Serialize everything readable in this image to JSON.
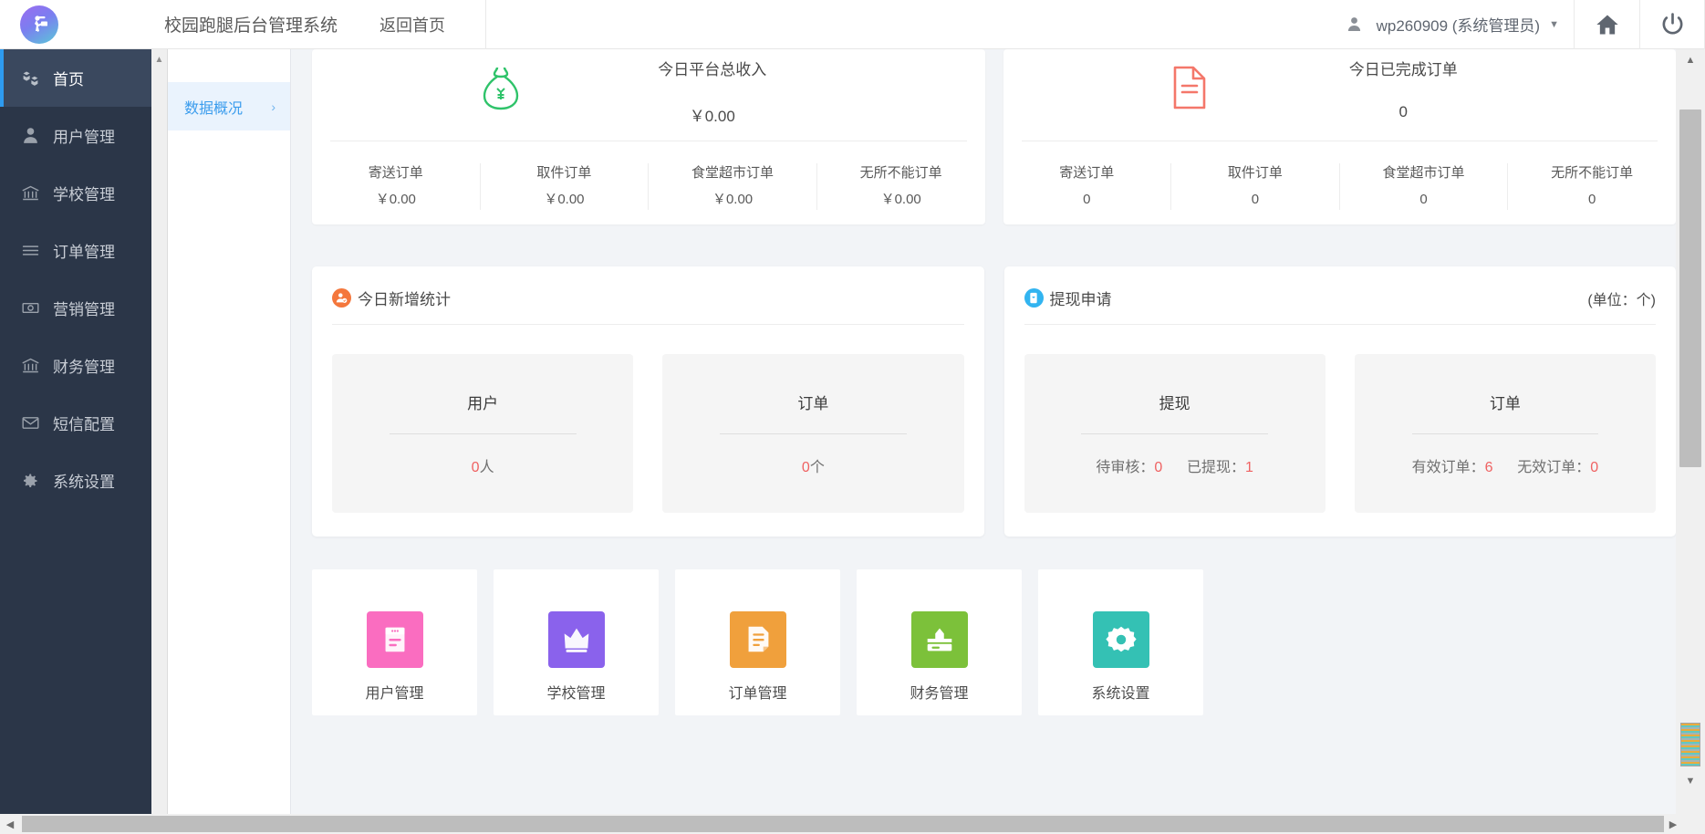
{
  "header": {
    "app_title": "校园跑腿后台管理系统",
    "home_link": "返回首页",
    "user_name": "wp260909 (系统管理员)",
    "caret": "▼",
    "home_button_name": "home",
    "power_button_name": "logout"
  },
  "sidebar": {
    "items": [
      {
        "label": "首页",
        "icon": "cubes-icon",
        "active": true
      },
      {
        "label": "用户管理",
        "icon": "user-icon",
        "active": false
      },
      {
        "label": "学校管理",
        "icon": "bank-icon",
        "active": false
      },
      {
        "label": "订单管理",
        "icon": "list-icon",
        "active": false
      },
      {
        "label": "营销管理",
        "icon": "money-icon",
        "active": false
      },
      {
        "label": "财务管理",
        "icon": "bank-icon",
        "active": false
      },
      {
        "label": "短信配置",
        "icon": "envelope-icon",
        "active": false
      },
      {
        "label": "系统设置",
        "icon": "gear-icon",
        "active": false
      }
    ]
  },
  "subnav": {
    "items": [
      {
        "label": "数据概况",
        "chevron": "›"
      }
    ]
  },
  "top_cards": [
    {
      "icon": "money-bag-icon",
      "icon_color": "#2fc36a",
      "title": "今日平台总收入",
      "value": "￥0.00",
      "sub": [
        {
          "label": "寄送订单",
          "value": "￥0.00"
        },
        {
          "label": "取件订单",
          "value": "￥0.00"
        },
        {
          "label": "食堂超市订单",
          "value": "￥0.00"
        },
        {
          "label": "无所不能订单",
          "value": "￥0.00"
        }
      ]
    },
    {
      "icon": "document-icon",
      "icon_color": "#f4776a",
      "title": "今日已完成订单",
      "value": "0",
      "sub": [
        {
          "label": "寄送订单",
          "value": "0"
        },
        {
          "label": "取件订单",
          "value": "0"
        },
        {
          "label": "食堂超市订单",
          "value": "0"
        },
        {
          "label": "无所不能订单",
          "value": "0"
        }
      ]
    }
  ],
  "panels": [
    {
      "title": "今日新增统计",
      "badge_icon": "user-add-icon",
      "badge_color": "#f4773c",
      "unit": "",
      "tiles": [
        {
          "title": "用户",
          "value_num": "0",
          "value_unit": "人",
          "parts": []
        },
        {
          "title": "订单",
          "value_num": "0",
          "value_unit": "个",
          "parts": []
        }
      ]
    },
    {
      "title": "提现申请",
      "badge_icon": "withdraw-icon",
      "badge_color": "#32b4f0",
      "unit": "(单位：个)",
      "tiles": [
        {
          "title": "提现",
          "parts": [
            {
              "label": "待审核：",
              "num": "0"
            },
            {
              "label": "已提现：",
              "num": "1"
            }
          ]
        },
        {
          "title": "订单",
          "parts": [
            {
              "label": "有效订单：",
              "num": "6"
            },
            {
              "label": "无效订单：",
              "num": "0"
            }
          ]
        }
      ]
    }
  ],
  "shortcuts": [
    {
      "label": "用户管理",
      "icon": "user-mgmt-icon",
      "color": "#fa6dc0"
    },
    {
      "label": "学校管理",
      "icon": "crown-icon",
      "color": "#8a62ec"
    },
    {
      "label": "订单管理",
      "icon": "order-doc-icon",
      "color": "#f0a03c"
    },
    {
      "label": "财务管理",
      "icon": "finance-upload-icon",
      "color": "#7cc13a"
    },
    {
      "label": "系统设置",
      "icon": "gear-tile-icon",
      "color": "#34c1b4"
    }
  ],
  "scrollbars": {
    "v_up": "▲",
    "v_down": "▼",
    "h_left": "◀",
    "h_right": "▶"
  }
}
